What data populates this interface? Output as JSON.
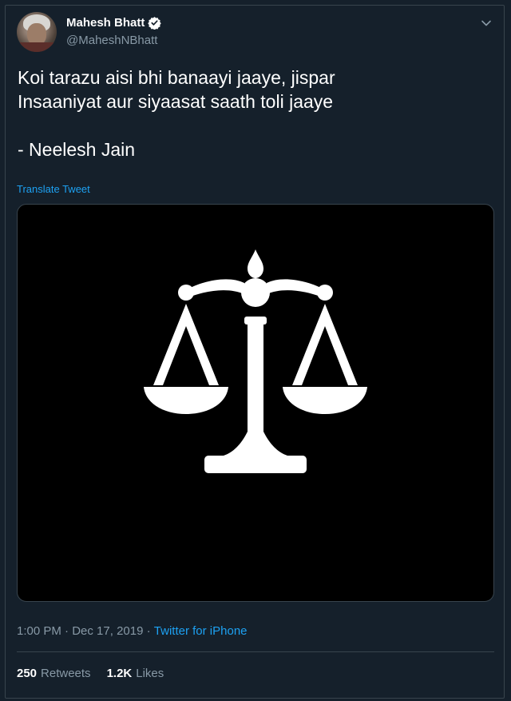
{
  "author": {
    "display_name": "Mahesh Bhatt",
    "handle": "@MaheshNBhatt",
    "verified_icon": "verified-badge-icon",
    "avatar": "profile-photo"
  },
  "tweet": {
    "lines": [
      "Koi tarazu aisi bhi banaayi jaaye, jispar",
      "Insaaniyat aur siyaasat saath toli jaaye",
      "",
      "- Neelesh Jain"
    ],
    "translate_label": "Translate Tweet",
    "media_icon": "scales-of-justice-icon"
  },
  "meta": {
    "time": "1:00 PM",
    "separator1": " · ",
    "date": "Dec 17, 2019",
    "separator2": " · ",
    "source": "Twitter for iPhone"
  },
  "stats": {
    "retweets_count": "250",
    "retweets_label": "Retweets",
    "likes_count": "1.2K",
    "likes_label": "Likes"
  },
  "colors": {
    "background": "#15202b",
    "accent": "#1da1f2",
    "secondary_text": "#8899a6",
    "border": "#38444d"
  }
}
